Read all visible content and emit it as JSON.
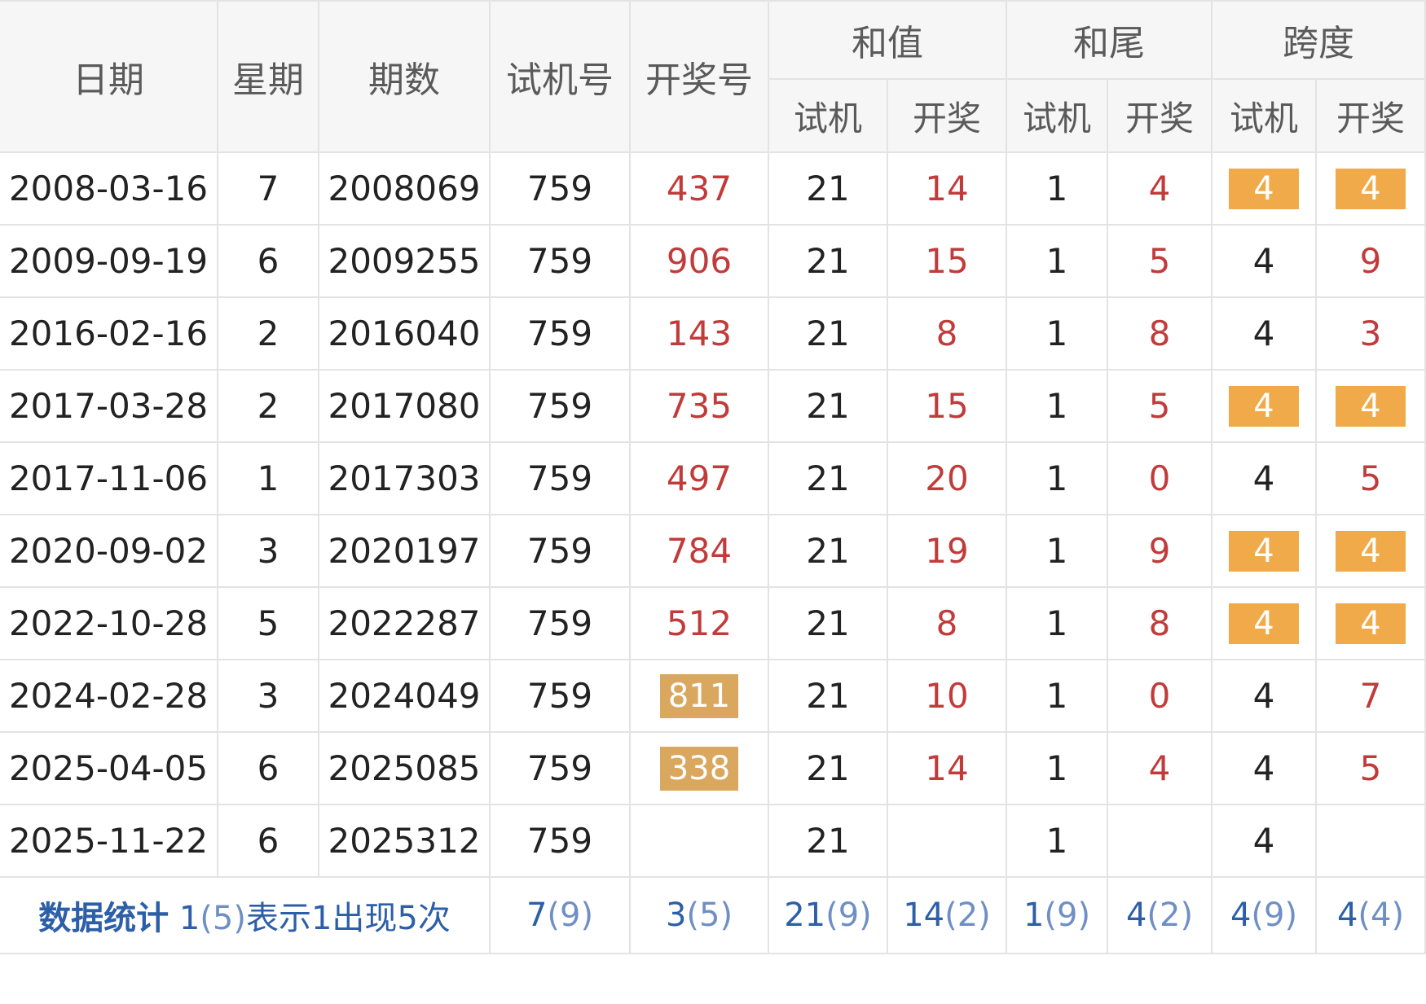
{
  "header": {
    "date": "日期",
    "weekday": "星期",
    "issue": "期数",
    "test_number": "试机号",
    "draw_number": "开奖号",
    "sum_group": "和值",
    "tail_group": "和尾",
    "span_group": "跨度",
    "sub_test": "试机",
    "sub_draw": "开奖"
  },
  "rows": [
    {
      "date": "2008-03-16",
      "weekday": "7",
      "issue": "2008069",
      "test": "759",
      "draw": "437",
      "sum_test": "21",
      "sum_draw": "14",
      "tail_test": "1",
      "tail_draw": "4",
      "span_test": "4",
      "span_draw": "4",
      "span_highlight": true,
      "draw_highlight": false
    },
    {
      "date": "2009-09-19",
      "weekday": "6",
      "issue": "2009255",
      "test": "759",
      "draw": "906",
      "sum_test": "21",
      "sum_draw": "15",
      "tail_test": "1",
      "tail_draw": "5",
      "span_test": "4",
      "span_draw": "9",
      "span_highlight": false,
      "draw_highlight": false
    },
    {
      "date": "2016-02-16",
      "weekday": "2",
      "issue": "2016040",
      "test": "759",
      "draw": "143",
      "sum_test": "21",
      "sum_draw": "8",
      "tail_test": "1",
      "tail_draw": "8",
      "span_test": "4",
      "span_draw": "3",
      "span_highlight": false,
      "draw_highlight": false
    },
    {
      "date": "2017-03-28",
      "weekday": "2",
      "issue": "2017080",
      "test": "759",
      "draw": "735",
      "sum_test": "21",
      "sum_draw": "15",
      "tail_test": "1",
      "tail_draw": "5",
      "span_test": "4",
      "span_draw": "4",
      "span_highlight": true,
      "draw_highlight": false
    },
    {
      "date": "2017-11-06",
      "weekday": "1",
      "issue": "2017303",
      "test": "759",
      "draw": "497",
      "sum_test": "21",
      "sum_draw": "20",
      "tail_test": "1",
      "tail_draw": "0",
      "span_test": "4",
      "span_draw": "5",
      "span_highlight": false,
      "draw_highlight": false
    },
    {
      "date": "2020-09-02",
      "weekday": "3",
      "issue": "2020197",
      "test": "759",
      "draw": "784",
      "sum_test": "21",
      "sum_draw": "19",
      "tail_test": "1",
      "tail_draw": "9",
      "span_test": "4",
      "span_draw": "4",
      "span_highlight": true,
      "draw_highlight": false
    },
    {
      "date": "2022-10-28",
      "weekday": "5",
      "issue": "2022287",
      "test": "759",
      "draw": "512",
      "sum_test": "21",
      "sum_draw": "8",
      "tail_test": "1",
      "tail_draw": "8",
      "span_test": "4",
      "span_draw": "4",
      "span_highlight": true,
      "draw_highlight": false
    },
    {
      "date": "2024-02-28",
      "weekday": "3",
      "issue": "2024049",
      "test": "759",
      "draw": "811",
      "sum_test": "21",
      "sum_draw": "10",
      "tail_test": "1",
      "tail_draw": "0",
      "span_test": "4",
      "span_draw": "7",
      "span_highlight": false,
      "draw_highlight": true
    },
    {
      "date": "2025-04-05",
      "weekday": "6",
      "issue": "2025085",
      "test": "759",
      "draw": "338",
      "sum_test": "21",
      "sum_draw": "14",
      "tail_test": "1",
      "tail_draw": "4",
      "span_test": "4",
      "span_draw": "5",
      "span_highlight": false,
      "draw_highlight": true
    },
    {
      "date": "2025-11-22",
      "weekday": "6",
      "issue": "2025312",
      "test": "759",
      "draw": "",
      "sum_test": "21",
      "sum_draw": "",
      "tail_test": "1",
      "tail_draw": "",
      "span_test": "4",
      "span_draw": "",
      "span_highlight": false,
      "draw_highlight": false
    }
  ],
  "stats": {
    "title": "数据统计",
    "note_value": "1",
    "note_paren": "(5)",
    "note_text": "表示1出现5次",
    "test": {
      "v": "7",
      "p": "(9)"
    },
    "draw": {
      "v": "3",
      "p": "(5)"
    },
    "sum_test": {
      "v": "21",
      "p": "(9)"
    },
    "sum_draw": {
      "v": "14",
      "p": "(2)"
    },
    "tail_test": {
      "v": "1",
      "p": "(9)"
    },
    "tail_draw": {
      "v": "4",
      "p": "(2)"
    },
    "span_test": {
      "v": "4",
      "p": "(9)"
    },
    "span_draw": {
      "v": "4",
      "p": "(4)"
    }
  },
  "colors": {
    "draw_red": "#c23b3b",
    "span_highlight": "#f0aa4a",
    "draw_highlight": "#d9a75e",
    "stats_blue": "#2c5fa8",
    "header_bg": "#f6f6f6"
  }
}
